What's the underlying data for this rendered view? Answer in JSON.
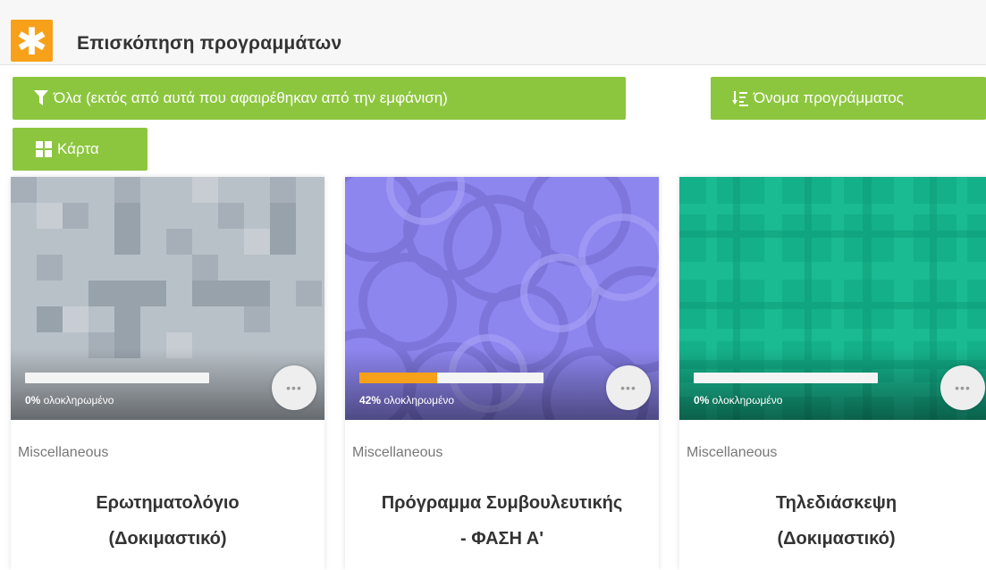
{
  "header": {
    "logo_glyph": "✱",
    "title": "Επισκόπηση προγραμμάτων"
  },
  "toolbar": {
    "filter_label": "Όλα (εκτός από αυτά που αφαιρέθηκαν από την εμφάνιση)",
    "filter_icon": "filter-icon",
    "sort_label": "Όνομα προγράμματος",
    "sort_icon": "sort-icon",
    "view_label": "Κάρτα",
    "view_icon": "grid-icon"
  },
  "colors": {
    "brand_orange": "#f7a11a",
    "button_green": "#8cc63e"
  },
  "cards": [
    {
      "progress_value": "0%",
      "progress_suffix": " ολοκληρωμένο",
      "progress_fraction": 0.0,
      "more_label": "•••",
      "category": "Miscellaneous",
      "title_line1": "Ερωτηματολόγιο",
      "title_line2": "(Δοκιμαστικό)",
      "pattern_color": "#b7bfc6"
    },
    {
      "progress_value": "42%",
      "progress_suffix": " ολοκληρωμένο",
      "progress_fraction": 0.42,
      "more_label": "•••",
      "category": "Miscellaneous",
      "title_line1": "Πρόγραμμα Συμβουλευτικής",
      "title_line2": "- ΦΑΣΗ Α'",
      "pattern_color": "#8f86f0"
    },
    {
      "progress_value": "0%",
      "progress_suffix": " ολοκληρωμένο",
      "progress_fraction": 0.0,
      "more_label": "•••",
      "category": "Miscellaneous",
      "title_line1": "Τηλεδιάσκεψη",
      "title_line2": "(Δοκιμαστικό)",
      "pattern_color": "#16b48a"
    }
  ]
}
